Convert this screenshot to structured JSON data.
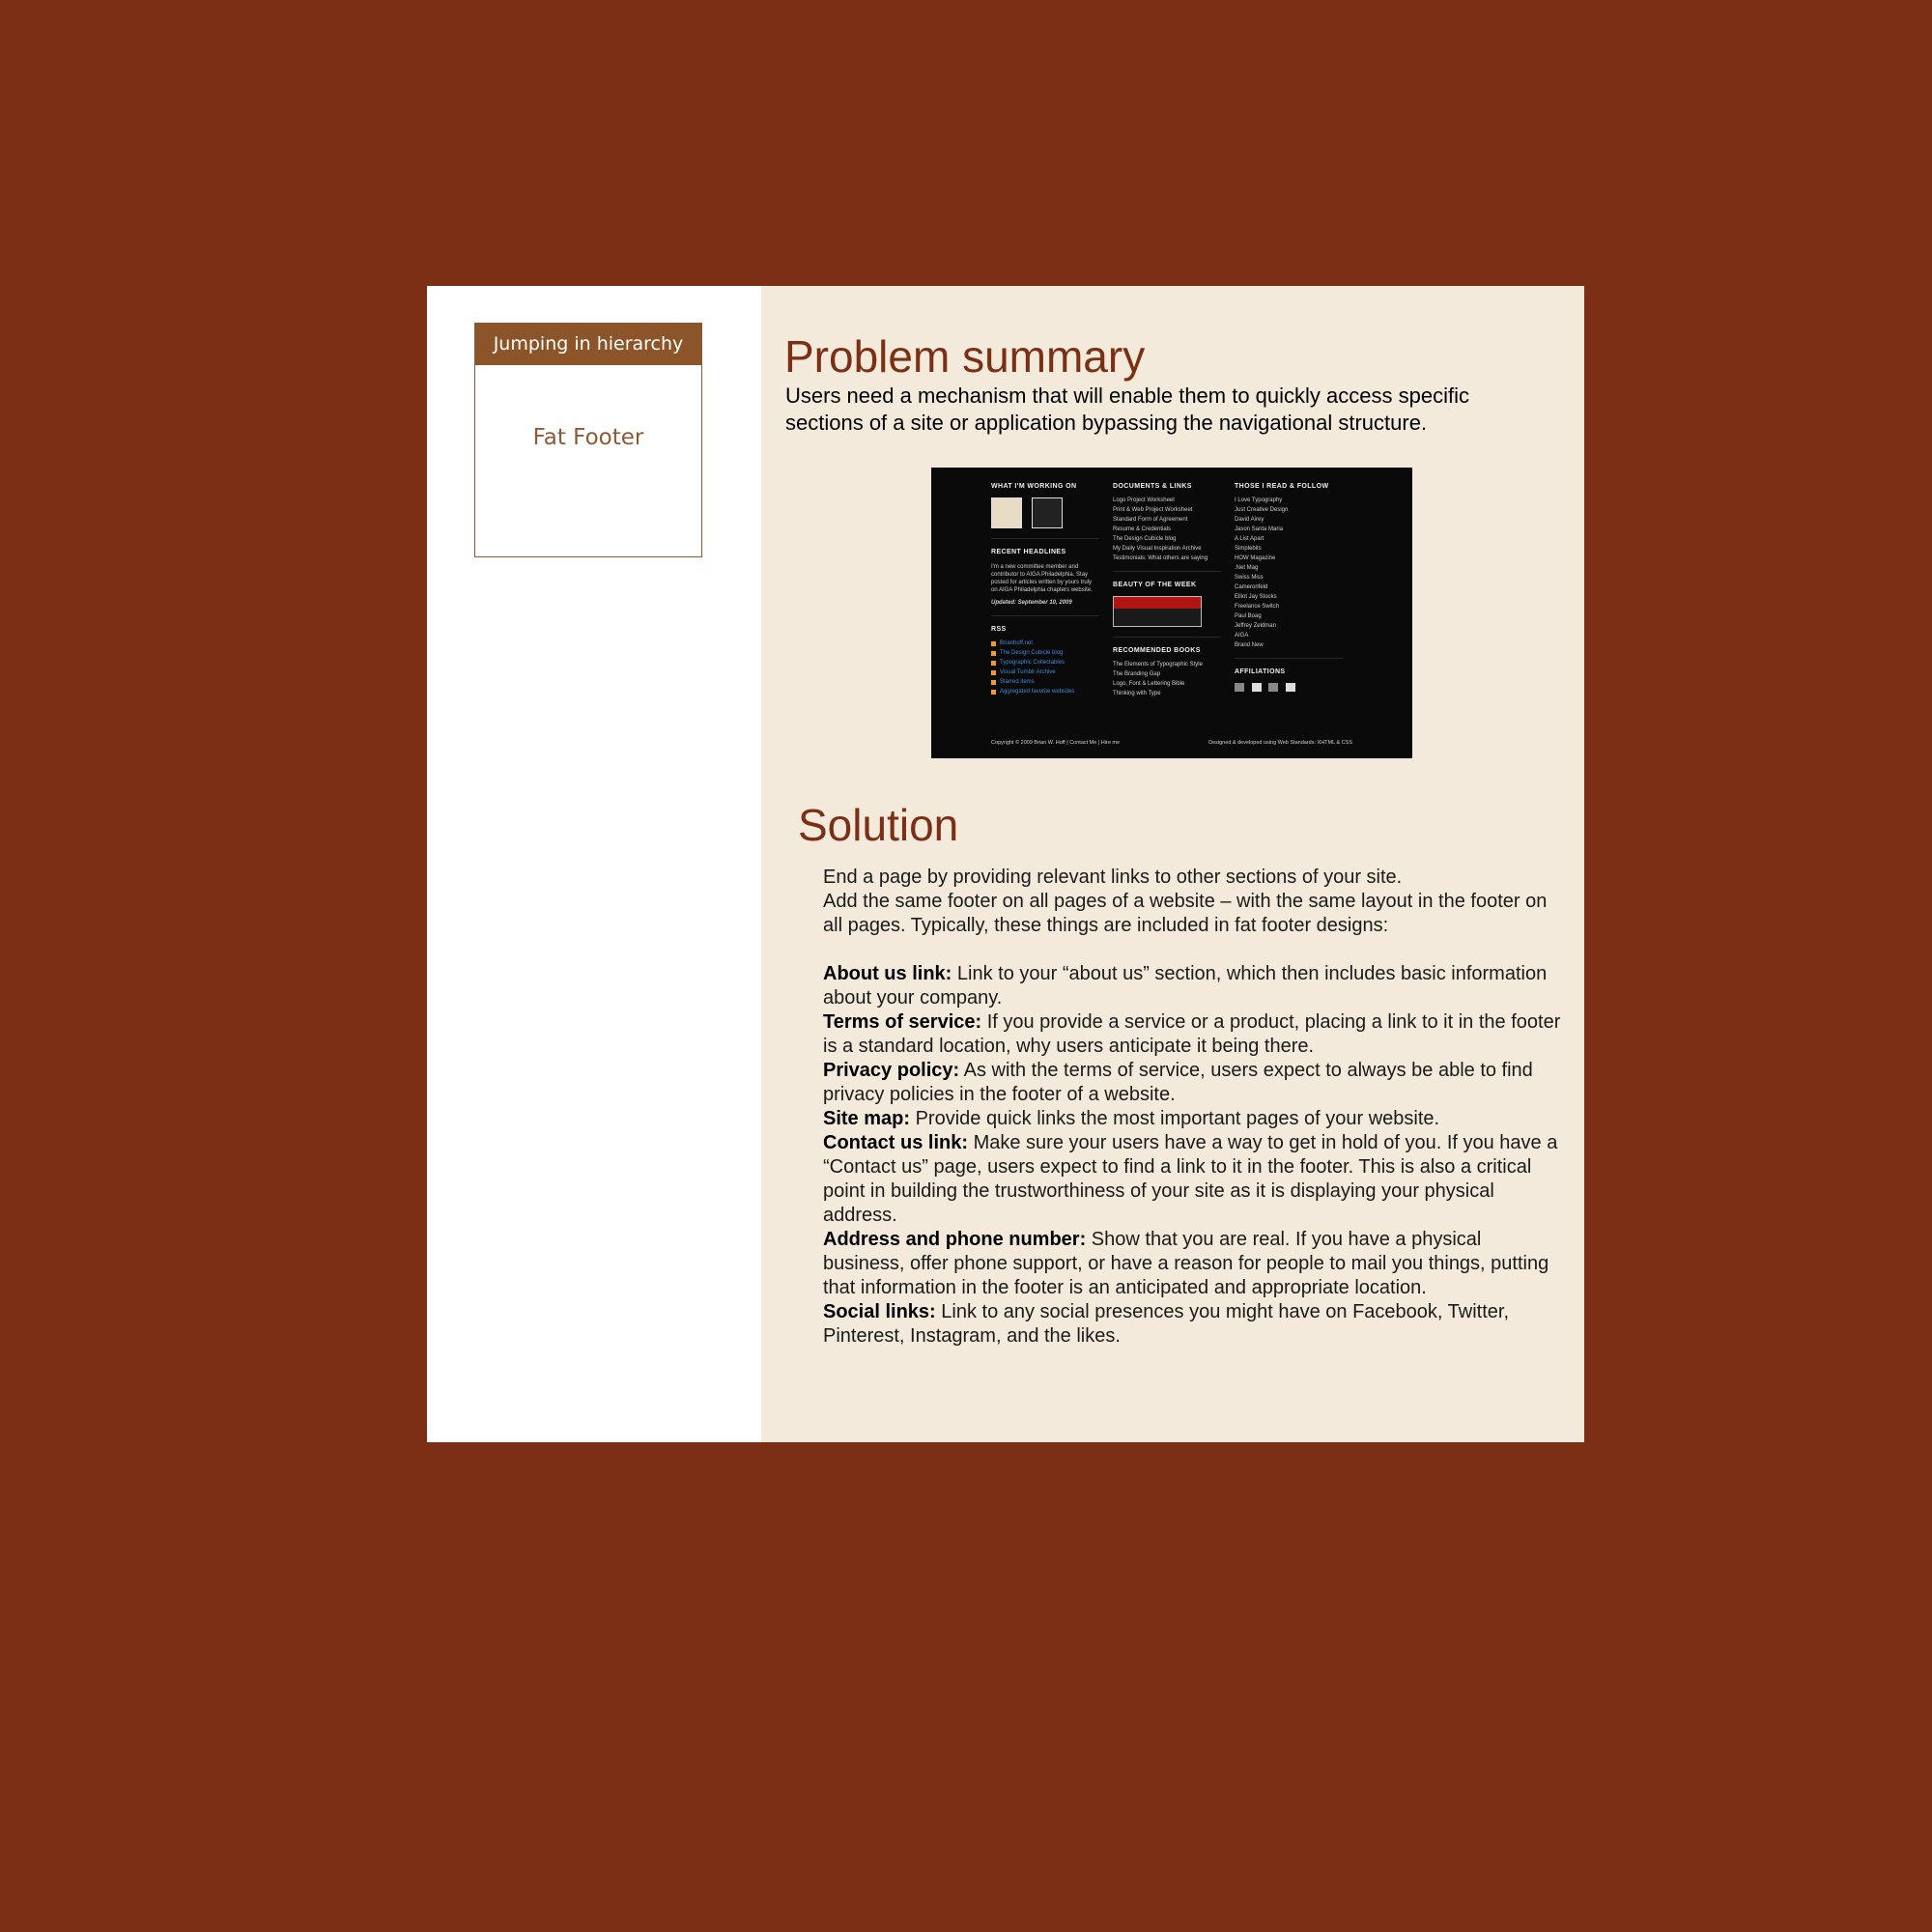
{
  "sidebar": {
    "category": "Jumping in hierarchy",
    "pattern_name": "Fat Footer"
  },
  "problem": {
    "title": "Problem summary",
    "text": "Users need a mechanism that will enable them to quickly access specific sections of a site or application bypassing the navigational structure."
  },
  "screenshot": {
    "col1": {
      "heading1": "WHAT I'M WORKING ON",
      "heading2": "RECENT HEADLINES",
      "headline_text": "I'm a new committee member and contributor to AIGA Philadelphia. Stay posted for articles written by yours truly on AIGA Philadelphia chapters website.",
      "updated": "Updated: September 10, 2009",
      "heading3": "RSS",
      "rss_items": [
        "Brianhoff.net",
        "The Design Cubicle blog",
        "Typographic Collectables",
        "Visual Tumblr Archive",
        "Starred items",
        "Aggregated favorite websites"
      ]
    },
    "col2": {
      "heading1": "DOCUMENTS & LINKS",
      "links": [
        "Logo Project Worksheet",
        "Print & Web Project Worksheet",
        "Standard Form of Agreement",
        "Resume & Credentials",
        "The Design Cubicle blog",
        "My Daily Visual Inspiration Archive",
        "Testimonials: What others are saying"
      ],
      "heading2": "BEAUTY OF THE WEEK",
      "heading3": "RECOMMENDED BOOKS",
      "books": [
        "The Elements of Typographic Style",
        "The Branding Gap",
        "Logo, Font & Lettering Bible",
        "Thinking with Type"
      ]
    },
    "col3": {
      "heading1": "THOSE I READ & FOLLOW",
      "follows": [
        "I Love Typography",
        "Just Creative Design",
        "David Airey",
        "Jason Santa Maria",
        "A List Apart",
        "Simplebits",
        "HOW Magazine",
        ".Net Mag",
        "Swiss Miss",
        "Cameronfeld",
        "Elliot Jay Stocks",
        "Freelance Switch",
        "Paul Boag",
        "Jeffrey Zeldman",
        "AIGA",
        "Brand New"
      ],
      "heading2": "AFFILIATIONS"
    },
    "footer_left": "Copyright © 2009 Brian W. Hoff | Contact Me | Hire me",
    "footer_right": "Designed & developed using Web Standards: XHTML & CSS"
  },
  "solution": {
    "title": "Solution",
    "intro1": "End a page by providing relevant links to other sections of your site.",
    "intro2": "Add the same footer on all pages of a website – with the same layout in the footer on all pages. Typically, these things are included in fat footer designs:",
    "items": [
      {
        "term": "About us link:",
        "text": " Link to your “about us” section, which then includes basic information about your company."
      },
      {
        "term": "Terms of service:",
        "text": " If you provide a service or a product, placing a link to it in the footer is a standard location, why users anticipate it being there."
      },
      {
        "term": "Privacy policy:",
        "text": " As with the terms of service, users expect to always be able to find privacy policies in the footer of a website."
      },
      {
        "term": "Site map:",
        "text": " Provide quick links the most important pages of your website."
      },
      {
        "term": "Contact us link:",
        "text": " Make sure your users have a way to get in hold of you. If you have a “Contact us” page, users expect to find a link to it in the footer. This is also a critical point in building the trustworthiness of your site as it is displaying your physical address."
      },
      {
        "term": "Address and phone number:",
        "text": " Show that you are real. If you have a physical business, offer phone support, or have a reason for people to mail you things, putting that information in the footer is an anticipated and appropriate location."
      },
      {
        "term": "Social links:",
        "text": " Link to any social presences you might have on Facebook, Twitter, Pinterest, Instagram, and the likes."
      }
    ]
  },
  "colors": {
    "background": "#7b3015",
    "panel": "#f3eadb",
    "accent": "#8b5529",
    "heading": "#7b3015"
  }
}
